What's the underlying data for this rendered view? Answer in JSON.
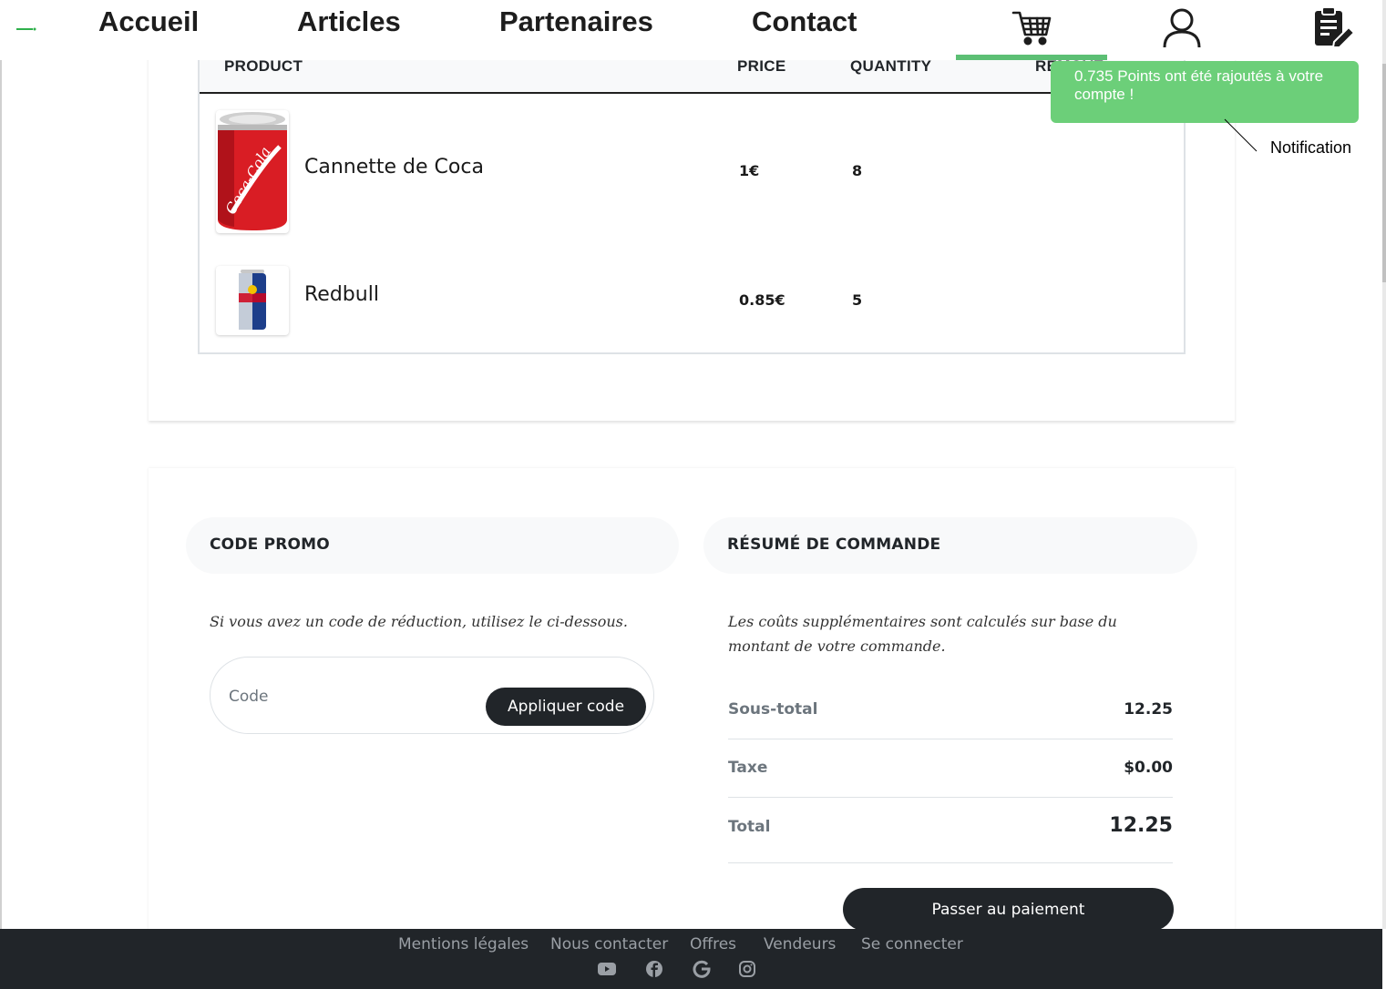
{
  "nav": {
    "logo": "",
    "items": [
      {
        "label": "Accueil"
      },
      {
        "label": "Articles"
      },
      {
        "label": "Partenaires"
      },
      {
        "label": "Contact"
      }
    ],
    "icons": [
      "cart-icon",
      "user-icon",
      "clipboard-edit-icon"
    ]
  },
  "cart": {
    "headers": {
      "product": "PRODUCT",
      "price": "PRICE",
      "quantity": "QUANTITY",
      "remove": "REMOVE"
    },
    "items": [
      {
        "name": "Cannette de Coca",
        "price": "1€",
        "quantity": "8",
        "image": "coca-can-image"
      },
      {
        "name": "Redbull",
        "price": "0.85€",
        "quantity": "5",
        "image": "redbull-can-image"
      }
    ]
  },
  "notification": {
    "message": "0.735 Points ont été rajoutés à votre compte !",
    "label": "Notification",
    "color": "#6ccf79"
  },
  "promo": {
    "title": "CODE PROMO",
    "description": "Si vous avez un code de réduction, utilisez le ci-dessous.",
    "placeholder": "Code",
    "button": "Appliquer code"
  },
  "summary": {
    "title": "RÉSUMÉ DE COMMANDE",
    "description": "Les coûts supplémentaires sont calculés sur base du montant de votre commande.",
    "rows": [
      {
        "label": "Sous-total",
        "value": "12.25"
      },
      {
        "label": "Taxe",
        "value": "$0.00"
      },
      {
        "label": "Total",
        "value": "12.25"
      }
    ],
    "checkout_button": "Passer au paiement"
  },
  "footer": {
    "links": [
      "Mentions légales",
      "Nous contacter",
      "Offres",
      "Vendeurs",
      "Se connecter"
    ],
    "icons": [
      "youtube-icon",
      "facebook-icon",
      "google-icon",
      "instagram-icon"
    ]
  },
  "colors": {
    "accent": "#5cbf74",
    "dark": "#212529"
  }
}
